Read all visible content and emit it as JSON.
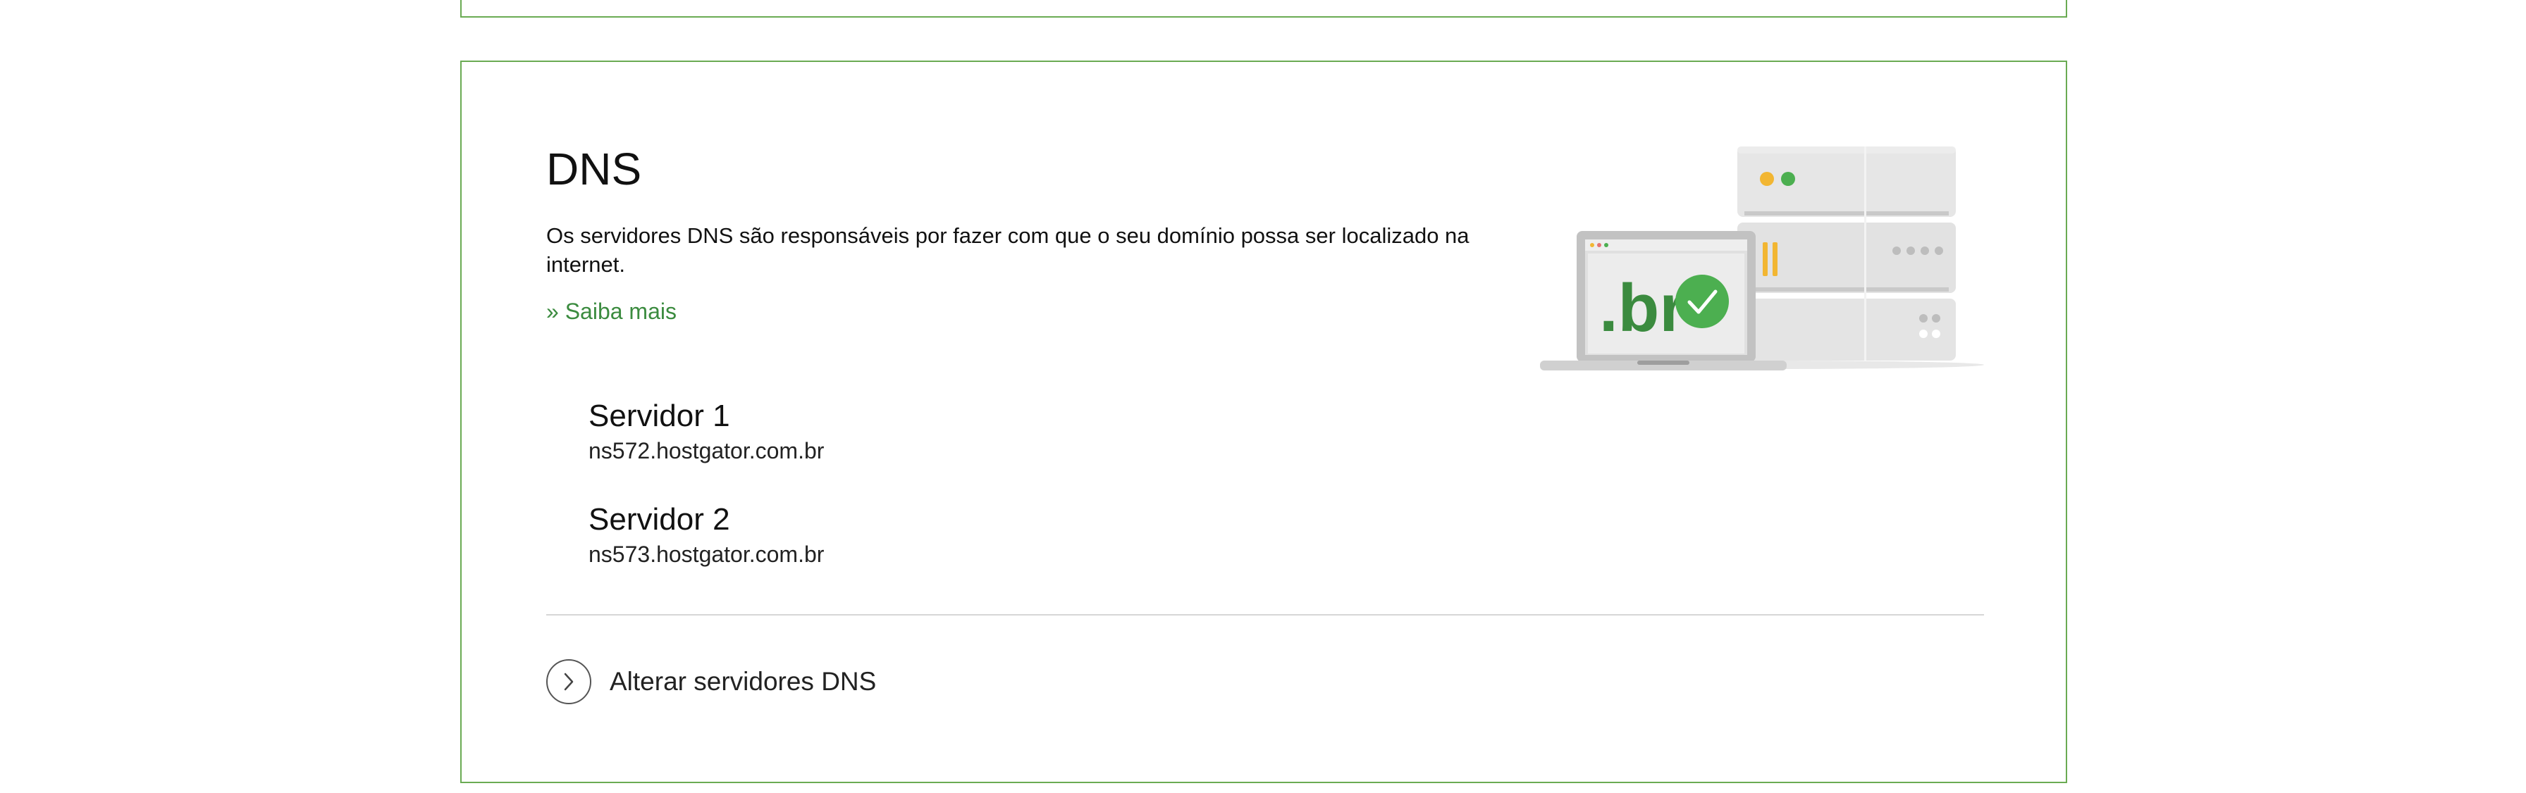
{
  "dns": {
    "title": "DNS",
    "description": "Os servidores DNS são responsáveis por fazer com que o seu domínio possa ser localizado na internet.",
    "learn_more": "» Saiba mais",
    "servers": [
      {
        "name": "Servidor 1",
        "host": "ns572.hostgator.com.br"
      },
      {
        "name": "Servidor 2",
        "host": "ns573.hostgator.com.br"
      }
    ],
    "change_action": "Alterar servidores DNS"
  },
  "illustration": {
    "laptop_logo": ".br",
    "icons": [
      "laptop-icon",
      "server-rack-icon",
      "check-icon"
    ]
  },
  "colors": {
    "card_border": "#6aab53",
    "link": "#3b8b3f",
    "check_green": "#4caf50",
    "server_yellow": "#f2b632"
  }
}
